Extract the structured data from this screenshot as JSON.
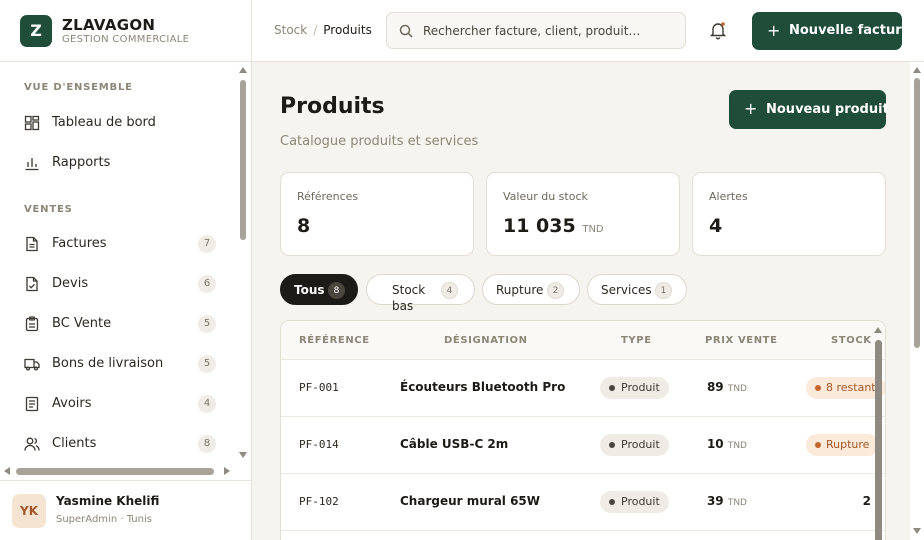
{
  "brand": {
    "logo": "Z",
    "name": "ZLAVAGON",
    "subtitle": "GESTION COMMERCIALE"
  },
  "sidebar": {
    "sections": [
      {
        "title": "VUE D'ENSEMBLE",
        "items": [
          {
            "label": "Tableau de bord",
            "icon": "dashboard-icon"
          },
          {
            "label": "Rapports",
            "icon": "bar-chart-icon"
          }
        ]
      },
      {
        "title": "VENTES",
        "items": [
          {
            "label": "Factures",
            "icon": "invoice-icon",
            "count": "7"
          },
          {
            "label": "Devis",
            "icon": "quote-icon",
            "count": "6"
          },
          {
            "label": "BC Vente",
            "icon": "clipboard-icon",
            "count": "5"
          },
          {
            "label": "Bons de livraison",
            "icon": "truck-icon",
            "count": "5"
          },
          {
            "label": "Avoirs",
            "icon": "credit-note-icon",
            "count": "4"
          },
          {
            "label": "Clients",
            "icon": "users-icon",
            "count": "8"
          }
        ]
      }
    ]
  },
  "user": {
    "initials": "YK",
    "name": "Yasmine Khelifi",
    "role": "SuperAdmin · Tunis"
  },
  "topbar": {
    "breadcrumb": {
      "parent": "Stock",
      "separator": "/",
      "current": "Produits"
    },
    "search_placeholder": "Rechercher facture, client, produit…",
    "new_invoice_label": "Nouvelle facture"
  },
  "page": {
    "title": "Produits",
    "subtitle": "Catalogue produits et services",
    "new_product_label": "Nouveau produit"
  },
  "stats": [
    {
      "label": "Références",
      "value": "8",
      "unit": ""
    },
    {
      "label": "Valeur du stock",
      "value": "11 035",
      "unit": "TND"
    },
    {
      "label": "Alertes",
      "value": "4",
      "unit": ""
    }
  ],
  "filters": [
    {
      "label": "Tous",
      "count": "8",
      "active": true
    },
    {
      "label": "Stock bas",
      "count": "4",
      "active": false
    },
    {
      "label": "Rupture",
      "count": "2",
      "active": false
    },
    {
      "label": "Services",
      "count": "1",
      "active": false
    }
  ],
  "table": {
    "columns": [
      "RÉFÉRENCE",
      "DÉSIGNATION",
      "TYPE",
      "PRIX VENTE",
      "STOCK"
    ],
    "rows": [
      {
        "ref": "PF-001",
        "designation": "Écouteurs Bluetooth Pro",
        "type": "Produit",
        "price": "89",
        "unit": "TND",
        "stock": "8 restant",
        "stock_kind": "badge"
      },
      {
        "ref": "PF-014",
        "designation": "Câble USB-C 2m",
        "type": "Produit",
        "price": "10",
        "unit": "TND",
        "stock": "Rupture",
        "stock_kind": "badge"
      },
      {
        "ref": "PF-102",
        "designation": "Chargeur mural 65W",
        "type": "Produit",
        "price": "39",
        "unit": "TND",
        "stock": "2",
        "stock_kind": "number"
      }
    ]
  },
  "colors": {
    "primary": "#1f4d3a",
    "background": "#f6f4ef",
    "warning": "#a4552a"
  }
}
